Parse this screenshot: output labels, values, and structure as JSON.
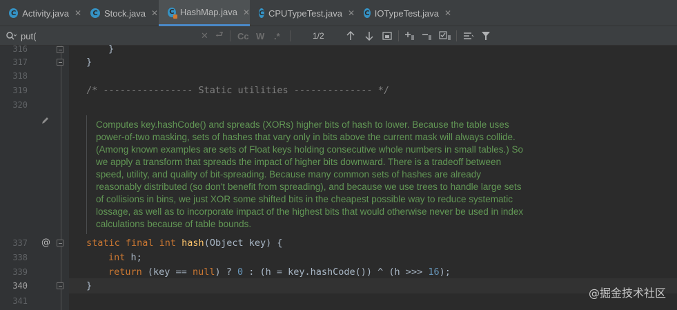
{
  "tabs": [
    {
      "label": "Activity.java",
      "icon": "class-icon"
    },
    {
      "label": "Stock.java",
      "icon": "class-icon"
    },
    {
      "label": "HashMap.java",
      "icon": "class-lib-icon",
      "active": true
    },
    {
      "label": "CPUTypeTest.java",
      "icon": "class-icon"
    },
    {
      "label": "IOTypeTest.java",
      "icon": "class-icon"
    }
  ],
  "tab_close": "✕",
  "search": {
    "value": "put(",
    "match_case": "Cc",
    "words": "W",
    "regex": ".*",
    "count": "1/2"
  },
  "lines": {
    "n316": "316",
    "n317": "317",
    "n318": "318",
    "n319": "319",
    "n320": "320",
    "n337": "337",
    "n338": "338",
    "n339": "339",
    "n340": "340",
    "n341": "341"
  },
  "code": {
    "l316": "}",
    "l317": "}",
    "l319": "/* ---------------- Static utilities -------------- */",
    "l337_kw": "static final int ",
    "l337_fn": "hash",
    "l337_rest": "(Object key) {",
    "l338_kw": "int",
    "l338_rest": " h;",
    "l339_kw1": "return",
    "l339_a": " (key == ",
    "l339_kw2": "null",
    "l339_b": ") ? ",
    "l339_n1": "0",
    "l339_c": " : (h = key.hashCode()) ^ (h >>> ",
    "l339_n2": "16",
    "l339_d": ");",
    "l340": "}"
  },
  "doc": "Computes key.hashCode() and spreads (XORs) higher bits of hash to lower. Because the table uses power-of-two masking, sets of hashes that vary only in bits above the current mask will always collide. (Among known examples are sets of Float keys holding consecutive whole numbers in small tables.) So we apply a transform that spreads the impact of higher bits downward. There is a tradeoff between speed, utility, and quality of bit-spreading. Because many common sets of hashes are already reasonably distributed (so don't benefit from spreading), and because we use trees to handle large sets of collisions in bins, we just XOR some shifted bits in the cheapest possible way to reduce systematic lossage, as well as to incorporate impact of the highest bits that would otherwise never be used in index calculations because of table bounds.",
  "gutter_annotation": "@",
  "watermark": "@掘金技术社区"
}
